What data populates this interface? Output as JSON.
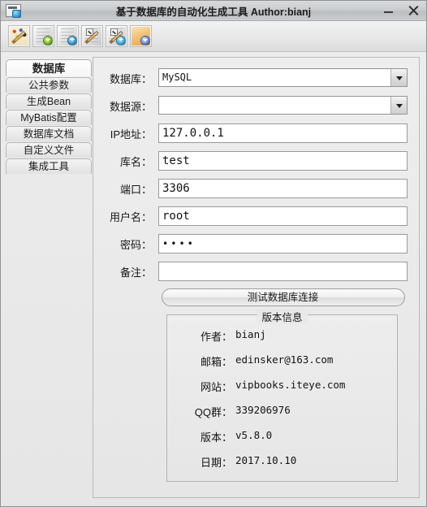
{
  "window": {
    "title": "基于数据库的自动化生成工具 Author:bianj",
    "icon": "app-window-icon",
    "minimize_label": "−",
    "close_label": "✕"
  },
  "toolbar": {
    "buttons": [
      {
        "name": "new-project",
        "tooltip": "新建"
      },
      {
        "name": "open-config-green",
        "tooltip": "打开"
      },
      {
        "name": "open-config-blue",
        "tooltip": "添加"
      },
      {
        "name": "edit-config",
        "tooltip": "编辑"
      },
      {
        "name": "add-config",
        "tooltip": "新增"
      },
      {
        "name": "download-config",
        "tooltip": "导入"
      }
    ]
  },
  "sidebar": {
    "items": [
      {
        "label": "数据库",
        "selected": true
      },
      {
        "label": "公共参数",
        "selected": false
      },
      {
        "label": "生成Bean",
        "selected": false
      },
      {
        "label": "MyBatis配置",
        "selected": false
      },
      {
        "label": "数据库文档",
        "selected": false
      },
      {
        "label": "自定义文件",
        "selected": false
      },
      {
        "label": "集成工具",
        "selected": false
      }
    ]
  },
  "form": {
    "database": {
      "label": "数据库：",
      "value": "MySQL",
      "type": "combo"
    },
    "datasource": {
      "label": "数据源：",
      "value": "",
      "type": "combo"
    },
    "ip": {
      "label": "IP地址：",
      "value": "127.0.0.1",
      "type": "text"
    },
    "dbname": {
      "label": "库名：",
      "value": "test",
      "type": "text"
    },
    "port": {
      "label": "端口：",
      "value": "3306",
      "type": "text"
    },
    "username": {
      "label": "用户名：",
      "value": "root",
      "type": "text"
    },
    "password": {
      "label": "密码：",
      "value": "••••",
      "type": "password"
    },
    "remark": {
      "label": "备注：",
      "value": "",
      "type": "text"
    },
    "test_button": "测试数据库连接"
  },
  "version_info": {
    "title": "版本信息",
    "rows": [
      {
        "key": "作者：",
        "value": "bianj"
      },
      {
        "key": "邮箱：",
        "value": "edinsker@163.com"
      },
      {
        "key": "网站：",
        "value": "vipbooks.iteye.com"
      },
      {
        "key": "QQ群：",
        "value": "339206976"
      },
      {
        "key": "版本：",
        "value": "v5.8.0"
      },
      {
        "key": "日期：",
        "value": "2017.10.10"
      }
    ]
  },
  "colors": {
    "window_bg": "#e6e6e6",
    "titlebar": "#c9cbcd",
    "field_bg": "#ffffff",
    "border": "#9a9a9a",
    "text": "#131313"
  }
}
